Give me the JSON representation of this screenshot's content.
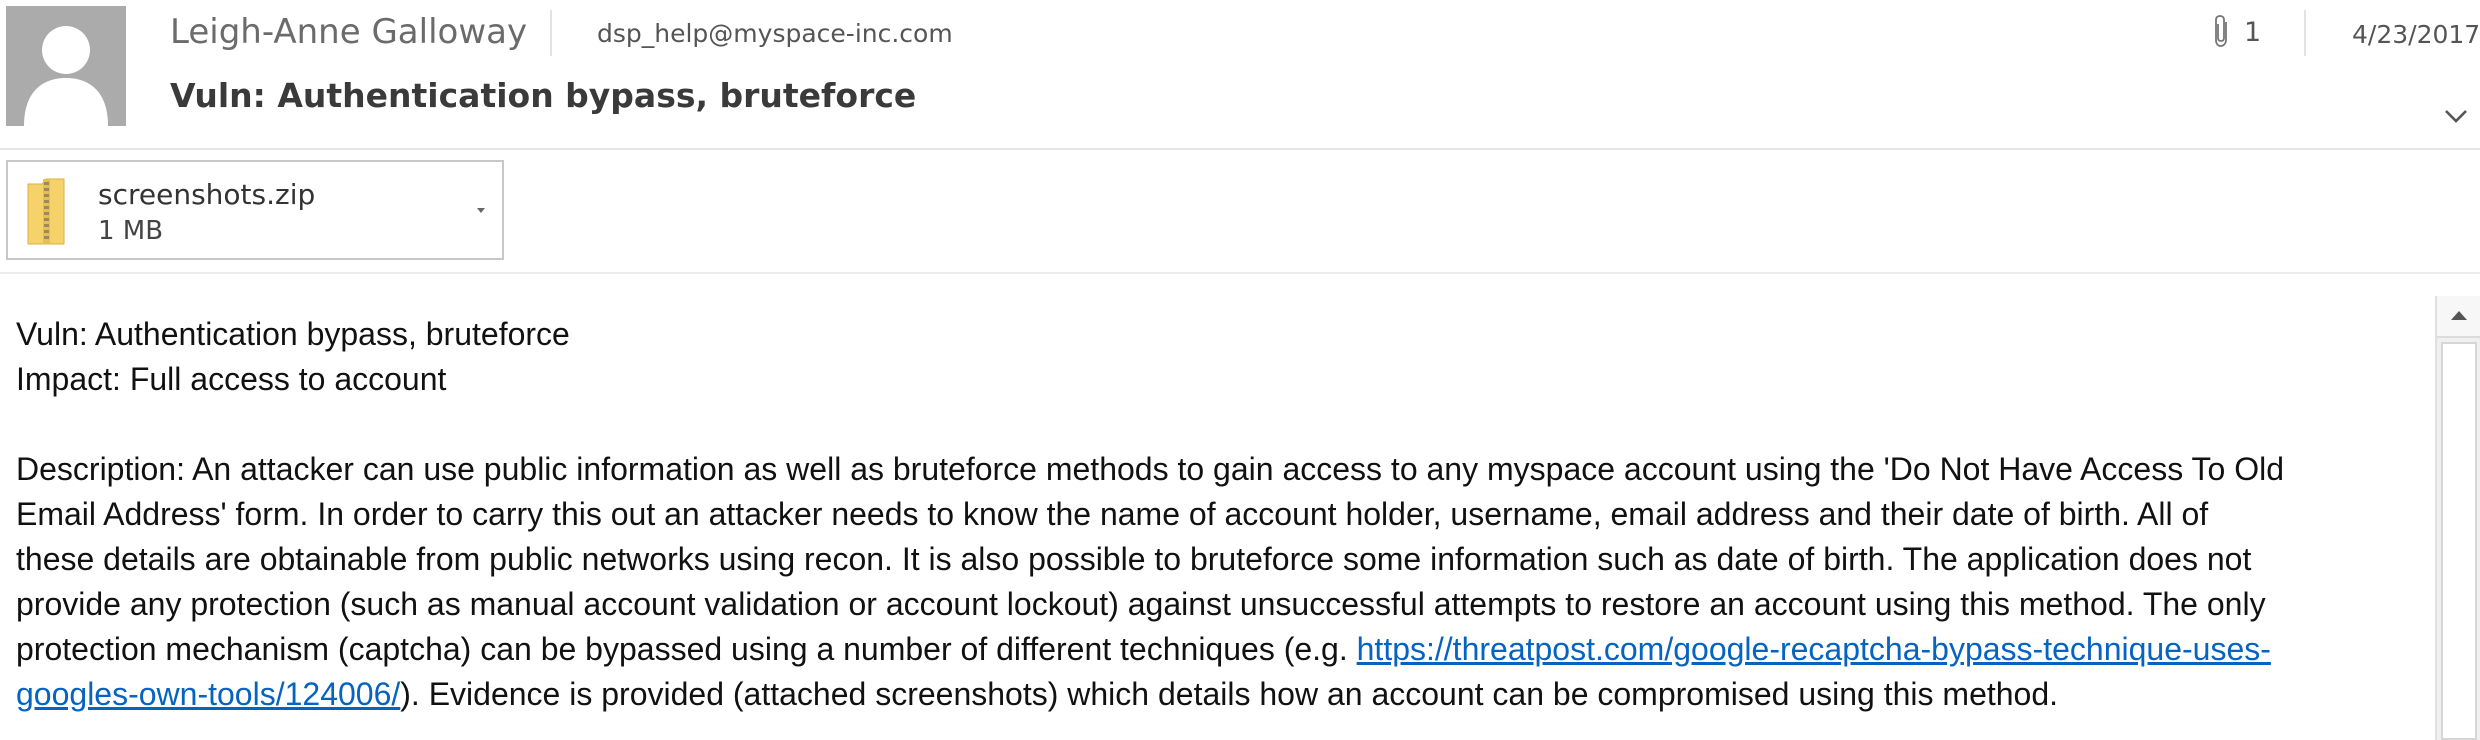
{
  "header": {
    "sender_name": "Leigh-Anne Galloway",
    "sender_email": "dsp_help@myspace-inc.com",
    "subject": "Vuln: Authentication bypass, bruteforce",
    "attachment_count": "1",
    "date": "4/23/2017",
    "icons": {
      "avatar": "person-silhouette-icon",
      "paperclip": "paperclip-icon",
      "expand": "chevron-down-icon"
    }
  },
  "attachment": {
    "file_name": "screenshots.zip",
    "file_size": "1 MB",
    "icon": "zip-folder-icon"
  },
  "body": {
    "line1": "Vuln: Authentication bypass, bruteforce",
    "line2": "Impact: Full access to account",
    "desc_lines": [
      "Description: An attacker can use public information as well as bruteforce methods to gain access to any myspace account using the 'Do Not Have Access To Old",
      "Email Address' form. In order to carry this out an attacker needs to know the name of account holder, username, email address and their date of birth. All of",
      "these details are obtainable from public networks using recon. It is also possible to bruteforce some information such as date of birth. The application does not",
      "provide any protection (such as manual account validation or account lockout) against unsuccessful attempts to restore an account using this method. The only"
    ],
    "desc_line5_pre": "protection mechanism (captcha) can be bypassed using a number of different techniques (e.g. ",
    "link_part1": "https://threatpost.com/google-recaptcha-bypass-technique-uses-",
    "link_part2": "googles-own-tools/124006/",
    "desc_line6_post": "). Evidence is provided (attached screenshots) which details how an account can be compromised using this method."
  },
  "colors": {
    "link": "#0563c1",
    "avatar_bg": "#ababab",
    "zip_folder": "#f6d36a"
  }
}
